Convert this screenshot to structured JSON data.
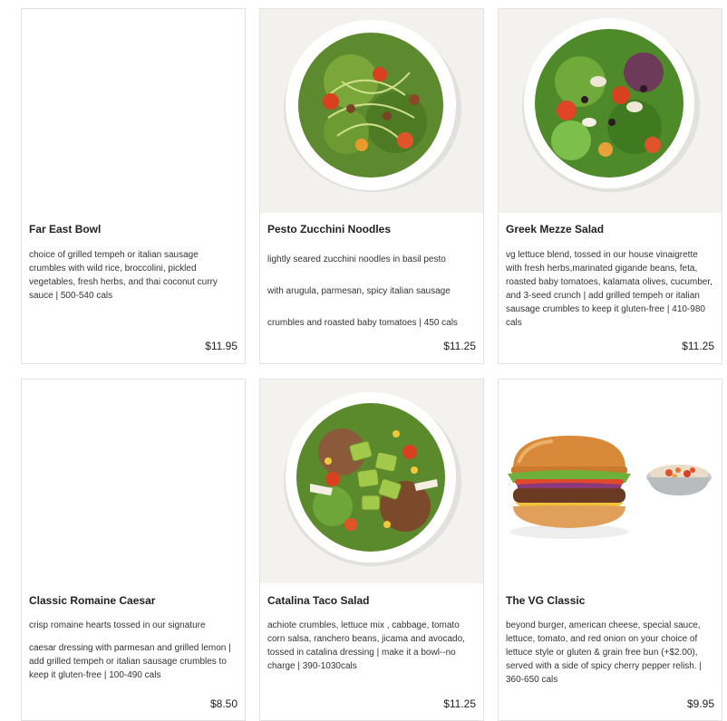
{
  "menu": {
    "items": [
      {
        "name": "Far East Bowl",
        "description": [
          "choice of grilled tempeh or italian sausage crumbles with wild rice, broccolini, pickled vegetables, fresh herbs, and thai coconut curry sauce | 500-540 cals"
        ],
        "price": "$11.95",
        "image": "none"
      },
      {
        "name": "Pesto Zucchini Noodles",
        "description": [
          "lightly seared zucchini noodles in basil pesto",
          "with arugula, parmesan, spicy italian sausage",
          "crumbles and roasted baby tomatoes | 450 cals"
        ],
        "price": "$11.25",
        "image": "zucchini-noodle-bowl-photo"
      },
      {
        "name": "Greek Mezze Salad",
        "description": [
          "vg lettuce blend, tossed in our house vinaigrette with fresh herbs,marinated gigande beans, feta, roasted baby tomatoes, kalamata olives, cucumber, and 3-seed crunch | add grilled tempeh or italian sausage crumbles to keep it gluten-free | 410-980 cals"
        ],
        "price": "$11.25",
        "image": "greek-salad-bowl-photo"
      },
      {
        "name": "Classic Romaine Caesar",
        "description": [
          "crisp romaine hearts tossed in our signature",
          "caesar dressing with parmesan and grilled lemon | add grilled tempeh or italian sausage crumbles to keep it gluten-free | 100-490 cals"
        ],
        "price": "$8.50",
        "image": "none"
      },
      {
        "name": "Catalina Taco Salad",
        "description": [
          "achiote crumbles, lettuce mix , cabbage, tomato corn salsa, ranchero beans, jicama and avocado, tossed in catalina dressing | make it a bowl--no charge | 390-1030cals"
        ],
        "price": "$11.25",
        "image": "taco-salad-bowl-photo"
      },
      {
        "name": "The VG Classic",
        "description": [
          "beyond burger, american cheese, special sauce, lettuce, tomato, and red onion on your choice of lettuce style or gluten & grain free bun (+$2.00), served with a side of spicy cherry pepper relish. | 360-650 cals"
        ],
        "price": "$9.95",
        "image": "burger-with-relish-photo"
      }
    ]
  }
}
